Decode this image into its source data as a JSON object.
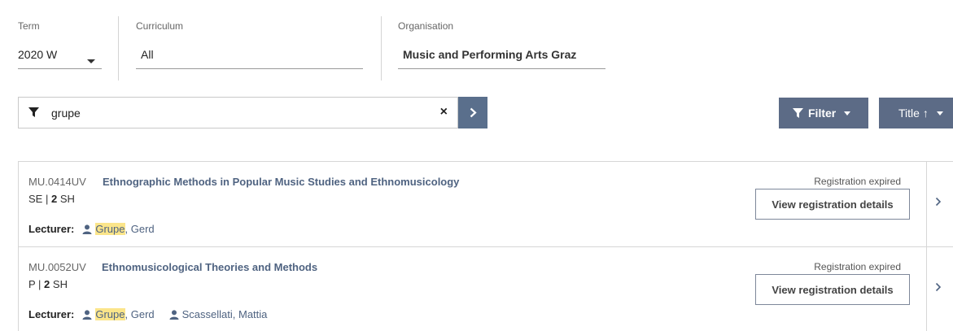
{
  "filters": {
    "term": {
      "label": "Term",
      "value": "2020 W"
    },
    "curriculum": {
      "label": "Curriculum",
      "value": "All"
    },
    "organisation": {
      "label": "Organisation",
      "value": "Music and Performing Arts Graz"
    }
  },
  "search": {
    "value": "grupe",
    "clear_glyph": "×",
    "submit_icon": "chevron-right-icon"
  },
  "toolbar": {
    "filter_label": "Filter",
    "sort_label": "Title ↑"
  },
  "courses": [
    {
      "code": "MU.0414UV",
      "title": "Ethnographic Methods in Popular Music Studies and Ethnomusicology",
      "type": "SE",
      "hours": "2",
      "hours_unit": "SH",
      "lecturer_label": "Lecturer:",
      "lecturers": [
        {
          "highlight": "Grupe",
          "rest": ", Gerd"
        }
      ],
      "status": "Registration expired",
      "button": "View registration details"
    },
    {
      "code": "MU.0052UV",
      "title": "Ethnomusicological Theories and Methods",
      "type": "P",
      "hours": "2",
      "hours_unit": "SH",
      "lecturer_label": "Lecturer:",
      "lecturers": [
        {
          "highlight": "Grupe",
          "rest": ", Gerd"
        },
        {
          "highlight": "",
          "rest": "Scassellati, Mattia"
        }
      ],
      "status": "Registration expired",
      "button": "View registration details"
    }
  ],
  "colors": {
    "accent": "#5a6f8c",
    "link": "#4f6381",
    "highlight": "#fbe58a"
  }
}
